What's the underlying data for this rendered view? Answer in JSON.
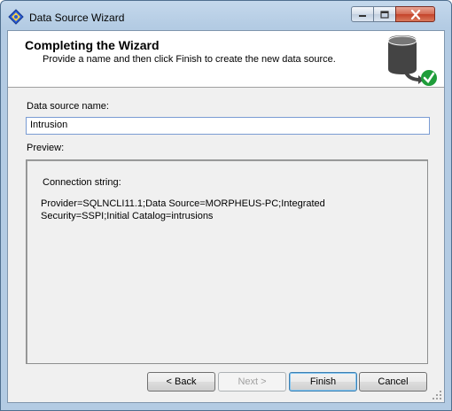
{
  "window": {
    "title": "Data Source Wizard",
    "icon": "wizard-diamond-icon",
    "controls": {
      "minimize_icon": "minimize-icon",
      "maximize_icon": "maximize-icon",
      "close_icon": "close-icon"
    }
  },
  "header": {
    "title": "Completing the Wizard",
    "subtitle": "Provide a name and then click Finish to create the new data source.",
    "graphic_icon": "database-check-icon"
  },
  "form": {
    "name_label": "Data source name:",
    "name_value": "Intrusion",
    "preview_label": "Preview:",
    "connection_label": "Connection string:",
    "connection_value": "Provider=SQLNCLI11.1;Data Source=MORPHEUS-PC;Integrated Security=SSPI;Initial Catalog=intrusions"
  },
  "buttons": {
    "back": "< Back",
    "next": "Next >",
    "finish": "Finish",
    "cancel": "Cancel"
  },
  "colors": {
    "title_bar": "#b9d1ea",
    "close_button": "#c4432a",
    "check_badge": "#1f9d3a"
  }
}
